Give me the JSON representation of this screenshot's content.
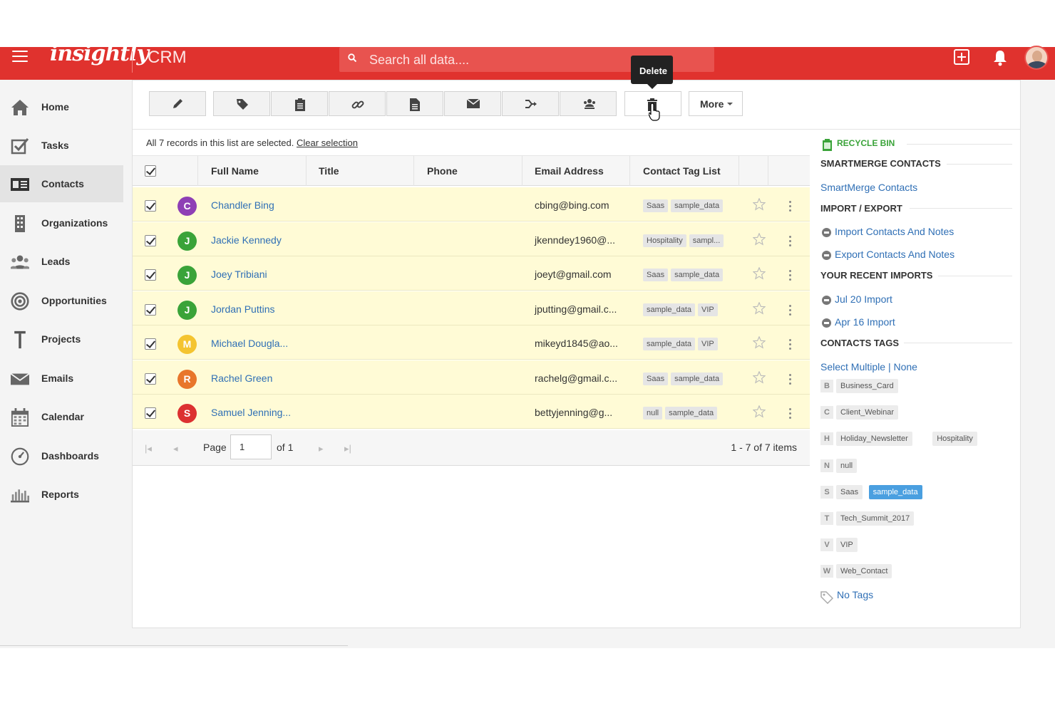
{
  "app": {
    "logo": "insightly",
    "product": "CRM"
  },
  "search": {
    "placeholder": "Search all data...."
  },
  "sidebar": {
    "items": [
      {
        "label": "Home"
      },
      {
        "label": "Tasks"
      },
      {
        "label": "Contacts"
      },
      {
        "label": "Organizations"
      },
      {
        "label": "Leads"
      },
      {
        "label": "Opportunities"
      },
      {
        "label": "Projects"
      },
      {
        "label": "Emails"
      },
      {
        "label": "Calendar"
      },
      {
        "label": "Dashboards"
      },
      {
        "label": "Reports"
      }
    ]
  },
  "toolbar": {
    "more_label": "More",
    "tooltip": "Delete"
  },
  "selection": {
    "message": "All 7 records in this list are selected.",
    "clear_label": "Clear selection"
  },
  "table": {
    "headers": [
      "Full Name",
      "Title",
      "Phone",
      "Email Address",
      "Contact Tag List"
    ],
    "rows": [
      {
        "initial": "C",
        "color": "#8e3fb5",
        "name": "Chandler Bing",
        "email": "cbing@bing.com",
        "tags": [
          "Saas",
          "sample_data"
        ]
      },
      {
        "initial": "J",
        "color": "#3aa339",
        "name": "Jackie Kennedy",
        "email": "jkenndey1960@...",
        "tags": [
          "Hospitality",
          "sampl..."
        ]
      },
      {
        "initial": "J",
        "color": "#3aa339",
        "name": "Joey Tribiani",
        "email": "joeyt@gmail.com",
        "tags": [
          "Saas",
          "sample_data"
        ]
      },
      {
        "initial": "J",
        "color": "#3aa339",
        "name": "Jordan Puttins",
        "email": "jputting@gmail.c...",
        "tags": [
          "sample_data",
          "VIP"
        ]
      },
      {
        "initial": "M",
        "color": "#f4c430",
        "name": "Michael Dougla...",
        "email": "mikeyd1845@ao...",
        "tags": [
          "sample_data",
          "VIP"
        ]
      },
      {
        "initial": "R",
        "color": "#e8762b",
        "name": "Rachel Green",
        "email": "rachelg@gmail.c...",
        "tags": [
          "Saas",
          "sample_data"
        ]
      },
      {
        "initial": "S",
        "color": "#dc3131",
        "name": "Samuel Jenning...",
        "email": "bettyjenning@g...",
        "tags": [
          "null",
          "sample_data"
        ]
      }
    ]
  },
  "pager": {
    "page_label": "Page",
    "page_value": "1",
    "of_label": "of 1",
    "count": "1 - 7 of 7 items"
  },
  "right_panel": {
    "recycle_bin": "RECYCLE BIN",
    "smartmerge_head": "SMARTMERGE CONTACTS",
    "smartmerge_link": "SmartMerge Contacts",
    "import_head": "IMPORT / EXPORT",
    "import_link": "Import Contacts And Notes",
    "export_link": "Export Contacts And Notes",
    "recent_head": "YOUR RECENT IMPORTS",
    "recent_1": "Jul 20 Import",
    "recent_2": "Apr 16 Import",
    "tags_head": "CONTACTS TAGS",
    "select_multiple": "Select Multiple",
    "separator": "|",
    "none": "None",
    "tag_groups": [
      {
        "letter": "B",
        "tags": [
          "Business_Card"
        ]
      },
      {
        "letter": "C",
        "tags": [
          "Client_Webinar"
        ]
      },
      {
        "letter": "H",
        "tags": [
          "Holiday_Newsletter",
          "Hospitality"
        ]
      },
      {
        "letter": "N",
        "tags": [
          "null"
        ]
      },
      {
        "letter": "S",
        "tags": [
          "Saas",
          "sample_data"
        ]
      },
      {
        "letter": "T",
        "tags": [
          "Tech_Summit_2017"
        ]
      },
      {
        "letter": "V",
        "tags": [
          "VIP"
        ]
      },
      {
        "letter": "W",
        "tags": [
          "Web_Contact"
        ]
      }
    ],
    "no_tags": "No Tags"
  },
  "colors": {
    "brand": "#e0322e",
    "link": "#2f6fb5",
    "row_selected": "#fffbd6",
    "tag_selected": "#4a9fe0"
  }
}
